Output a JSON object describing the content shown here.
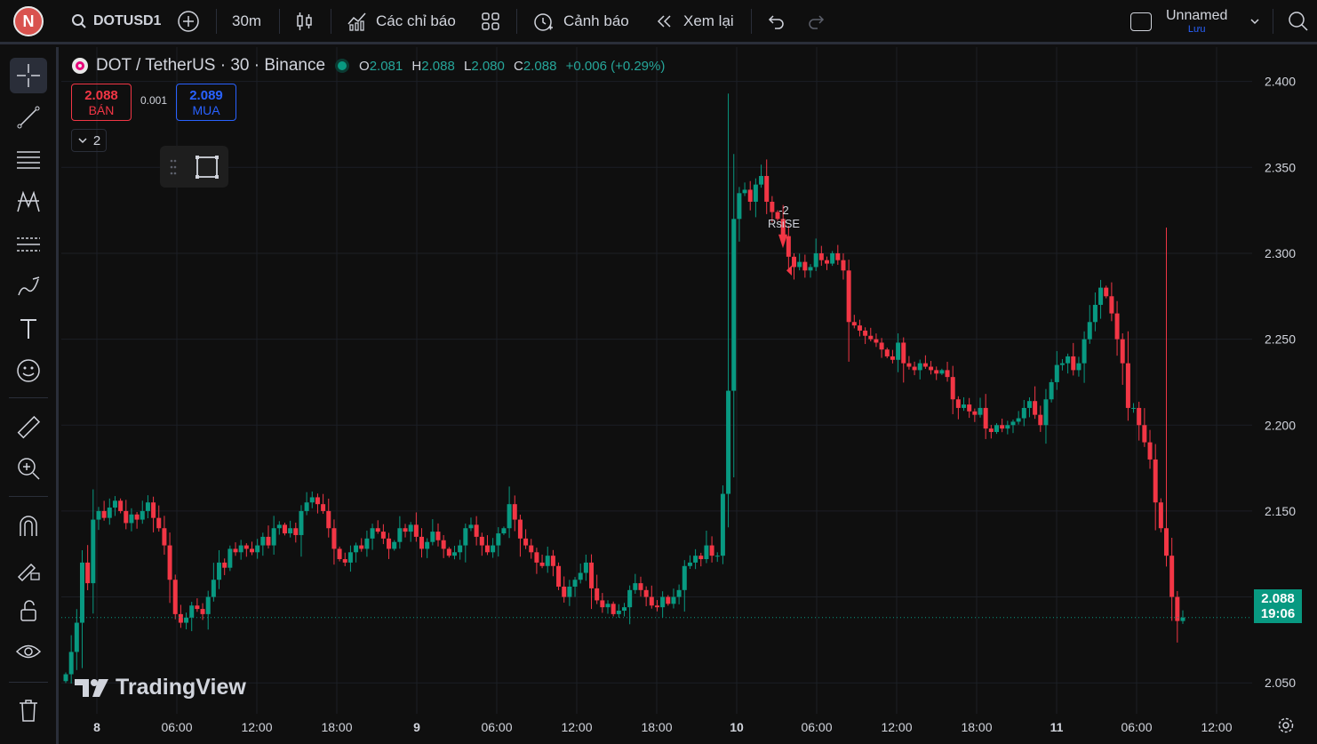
{
  "topbar": {
    "avatar_letter": "N",
    "symbol": "DOTUSD1",
    "interval": "30m",
    "indicators_label": "Các chỉ báo",
    "alerts_label": "Cảnh báo",
    "replay_label": "Xem lại",
    "layout_name": "Unnamed",
    "save_label": "Lưu"
  },
  "legend": {
    "title": "DOT / TetherUS · 30 · Binance",
    "o_key": "O",
    "o_val": "2.081",
    "h_key": "H",
    "h_val": "2.088",
    "l_key": "L",
    "l_val": "2.080",
    "c_key": "C",
    "c_val": "2.088",
    "change": "+0.006 (+0.29%)"
  },
  "trade": {
    "sell_price": "2.088",
    "sell_label": "BÁN",
    "spread": "0.001",
    "buy_price": "2.089",
    "buy_label": "MUA",
    "collapse_count": "2"
  },
  "annotation": {
    "line1": "-2",
    "line2": "RsiSE"
  },
  "price_badge": {
    "price": "2.088",
    "countdown": "19:06"
  },
  "watermark": "TradingView",
  "colors": {
    "up": "#089981",
    "down": "#f23645",
    "background": "#0f0f0f",
    "grid": "#1c1f26"
  },
  "chart_data": {
    "type": "candlestick",
    "y_ticks": [
      "2.400",
      "2.350",
      "2.300",
      "2.250",
      "2.200",
      "2.150",
      "2.100",
      "2.050"
    ],
    "x_ticks": [
      "8",
      "06:00",
      "12:00",
      "18:00",
      "9",
      "06:00",
      "12:00",
      "18:00",
      "10",
      "06:00",
      "12:00",
      "18:00",
      "11",
      "06:00",
      "12:00"
    ],
    "ylim": [
      2.032,
      2.42
    ],
    "current_price": 2.088,
    "closes": [
      2.055,
      2.068,
      2.085,
      2.12,
      2.108,
      2.145,
      2.15,
      2.146,
      2.152,
      2.156,
      2.15,
      2.143,
      2.148,
      2.145,
      2.15,
      2.155,
      2.146,
      2.14,
      2.13,
      2.11,
      2.09,
      2.085,
      2.088,
      2.095,
      2.093,
      2.09,
      2.1,
      2.11,
      2.12,
      2.117,
      2.128,
      2.126,
      2.13,
      2.128,
      2.126,
      2.13,
      2.135,
      2.13,
      2.14,
      2.142,
      2.137,
      2.14,
      2.136,
      2.15,
      2.155,
      2.158,
      2.154,
      2.15,
      2.14,
      2.128,
      2.122,
      2.12,
      2.126,
      2.13,
      2.128,
      2.134,
      2.14,
      2.138,
      2.134,
      2.128,
      2.132,
      2.14,
      2.138,
      2.142,
      2.135,
      2.128,
      2.132,
      2.138,
      2.133,
      2.128,
      2.124,
      2.126,
      2.13,
      2.14,
      2.142,
      2.135,
      2.13,
      2.126,
      2.13,
      2.137,
      2.14,
      2.154,
      2.145,
      2.134,
      2.13,
      2.126,
      2.12,
      2.118,
      2.124,
      2.118,
      2.106,
      2.1,
      2.106,
      2.11,
      2.114,
      2.12,
      2.105,
      2.098,
      2.094,
      2.096,
      2.09,
      2.092,
      2.094,
      2.104,
      2.108,
      2.104,
      2.1,
      2.095,
      2.094,
      2.1,
      2.096,
      2.1,
      2.104,
      2.118,
      2.12,
      2.124,
      2.122,
      2.13,
      2.124,
      2.124,
      2.16,
      2.22,
      2.32,
      2.335,
      2.337,
      2.33,
      2.34,
      2.345,
      2.33,
      2.324,
      2.32,
      2.31,
      2.298,
      2.292,
      2.295,
      2.29,
      2.292,
      2.3,
      2.296,
      2.294,
      2.3,
      2.296,
      2.29,
      2.26,
      2.258,
      2.255,
      2.252,
      2.25,
      2.248,
      2.244,
      2.24,
      2.238,
      2.248,
      2.236,
      2.234,
      2.232,
      2.236,
      2.234,
      2.232,
      2.23,
      2.232,
      2.228,
      2.215,
      2.21,
      2.212,
      2.208,
      2.206,
      2.21,
      2.198,
      2.196,
      2.2,
      2.198,
      2.2,
      2.202,
      2.204,
      2.21,
      2.214,
      2.206,
      2.2,
      2.215,
      2.225,
      2.235,
      2.236,
      2.24,
      2.232,
      2.236,
      2.25,
      2.26,
      2.27,
      2.28,
      2.275,
      2.265,
      2.25,
      2.236,
      2.21,
      2.21,
      2.2,
      2.19,
      2.18,
      2.155,
      2.14,
      2.124,
      2.1,
      2.086,
      2.088
    ],
    "series": [
      {
        "name": "DOT / TetherUS",
        "interval": "30"
      }
    ]
  }
}
